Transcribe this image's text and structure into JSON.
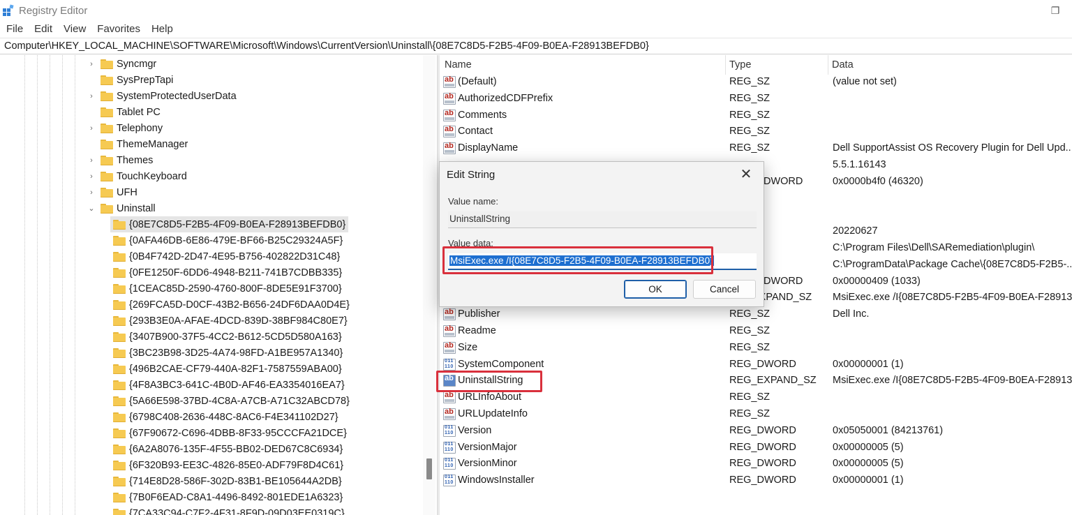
{
  "window": {
    "title": "Registry Editor",
    "restore_glyph": "❐"
  },
  "menu": [
    "File",
    "Edit",
    "View",
    "Favorites",
    "Help"
  ],
  "address": "Computer\\HKEY_LOCAL_MACHINE\\SOFTWARE\\Microsoft\\Windows\\CurrentVersion\\Uninstall\\{08E7C8D5-F2B5-4F09-B0EA-F28913BEFDB0}",
  "tree": {
    "items": [
      {
        "label": "Syncmgr",
        "chevron": "›"
      },
      {
        "label": "SysPrepTapi",
        "chevron": ""
      },
      {
        "label": "SystemProtectedUserData",
        "chevron": "›"
      },
      {
        "label": "Tablet PC",
        "chevron": ""
      },
      {
        "label": "Telephony",
        "chevron": "›"
      },
      {
        "label": "ThemeManager",
        "chevron": ""
      },
      {
        "label": "Themes",
        "chevron": "›"
      },
      {
        "label": "TouchKeyboard",
        "chevron": "›"
      },
      {
        "label": "UFH",
        "chevron": "›"
      },
      {
        "label": "Uninstall",
        "chevron": "⌄"
      }
    ],
    "children": [
      "{08E7C8D5-F2B5-4F09-B0EA-F28913BEFDB0}",
      "{0AFA46DB-6E86-479E-BF66-B25C29324A5F}",
      "{0B4F742D-2D47-4E95-B756-402822D31C48}",
      "{0FE1250F-6DD6-4948-B211-741B7CDBB335}",
      "{1CEAC85D-2590-4760-800F-8DE5E91F3700}",
      "{269FCA5D-D0CF-43B2-B656-24DF6DAA0D4E}",
      "{293B3E0A-AFAE-4DCD-839D-38BF984C80E7}",
      "{3407B900-37F5-4CC2-B612-5CD5D580A163}",
      "{3BC23B98-3D25-4A74-98FD-A1BE957A1340}",
      "{496B2CAE-CF79-440A-82F1-7587559ABA00}",
      "{4F8A3BC3-641C-4B0D-AF46-EA3354016EA7}",
      "{5A66E598-37BD-4C8A-A7CB-A71C32ABCD78}",
      "{6798C408-2636-448C-8AC6-F4E341102D27}",
      "{67F90672-C696-4DBB-8F33-95CCCFA21DCE}",
      "{6A2A8076-135F-4F55-BB02-DED67C8C6934}",
      "{6F320B93-EE3C-4826-85E0-ADF79F8D4C61}",
      "{714E8D28-586F-302D-83B1-BE105644A2DB}",
      "{7B0F6EAD-C8A1-4496-8492-801EDE1A6323}",
      "{7CA33C94-C7F2-4F31-8F9D-09D03EE0319C}"
    ],
    "selected_index": 0
  },
  "columns": {
    "name": "Name",
    "type": "Type",
    "data": "Data"
  },
  "values": [
    {
      "name": "(Default)",
      "type": "REG_SZ",
      "data": "(value not set)",
      "icon": "ab"
    },
    {
      "name": "AuthorizedCDFPrefix",
      "type": "REG_SZ",
      "data": "",
      "icon": "ab"
    },
    {
      "name": "Comments",
      "type": "REG_SZ",
      "data": "",
      "icon": "ab"
    },
    {
      "name": "Contact",
      "type": "REG_SZ",
      "data": "",
      "icon": "ab"
    },
    {
      "name": "DisplayName",
      "type": "REG_SZ",
      "data": "Dell SupportAssist OS Recovery Plugin for Dell Upd...",
      "icon": "ab"
    },
    {
      "name": "",
      "type": "",
      "data": "5.5.1.16143",
      "icon": ""
    },
    {
      "name": "",
      "type": "DWORD",
      "data": "0x0000b4f0 (46320)",
      "icon": ""
    },
    {
      "name": "",
      "type": "",
      "data": "",
      "icon": ""
    },
    {
      "name": "",
      "type": "",
      "data": "",
      "icon": ""
    },
    {
      "name": "",
      "type": "",
      "data": "20220627",
      "icon": ""
    },
    {
      "name": "",
      "type": "",
      "data": "C:\\Program Files\\Dell\\SARemediation\\plugin\\",
      "icon": ""
    },
    {
      "name": "",
      "type": "",
      "data": "C:\\ProgramData\\Package Cache\\{08E7C8D5-F2B5-...",
      "icon": ""
    },
    {
      "name": "",
      "type": "DWORD",
      "data": "0x00000409 (1033)",
      "icon": ""
    },
    {
      "name": "",
      "type": "EXPAND_SZ",
      "data": "MsiExec.exe /I{08E7C8D5-F2B5-4F09-B0EA-F28913...",
      "icon": ""
    },
    {
      "name": "Publisher",
      "type": "REG_SZ",
      "data": "Dell Inc.",
      "icon": "ab"
    },
    {
      "name": "Readme",
      "type": "REG_SZ",
      "data": "",
      "icon": "ab"
    },
    {
      "name": "Size",
      "type": "REG_SZ",
      "data": "",
      "icon": "ab"
    },
    {
      "name": "SystemComponent",
      "type": "REG_DWORD",
      "data": "0x00000001 (1)",
      "icon": "bin"
    },
    {
      "name": "UninstallString",
      "type": "REG_EXPAND_SZ",
      "data": "MsiExec.exe /I{08E7C8D5-F2B5-4F09-B0EA-F28913...",
      "icon": "exp"
    },
    {
      "name": "URLInfoAbout",
      "type": "REG_SZ",
      "data": "",
      "icon": "ab"
    },
    {
      "name": "URLUpdateInfo",
      "type": "REG_SZ",
      "data": "",
      "icon": "ab"
    },
    {
      "name": "Version",
      "type": "REG_DWORD",
      "data": "0x05050001 (84213761)",
      "icon": "bin"
    },
    {
      "name": "VersionMajor",
      "type": "REG_DWORD",
      "data": "0x00000005 (5)",
      "icon": "bin"
    },
    {
      "name": "VersionMinor",
      "type": "REG_DWORD",
      "data": "0x00000005 (5)",
      "icon": "bin"
    },
    {
      "name": "WindowsInstaller",
      "type": "REG_DWORD",
      "data": "0x00000001 (1)",
      "icon": "bin"
    }
  ],
  "dialog": {
    "title": "Edit String",
    "close_glyph": "✕",
    "value_name_label": "Value name:",
    "value_name": "UninstallString",
    "value_data_label": "Value data:",
    "value_data": "MsiExec.exe /I{08E7C8D5-F2B5-4F09-B0EA-F28913BEFDB0}",
    "ok_label": "OK",
    "cancel_label": "Cancel"
  },
  "colors": {
    "highlight": "#d9303c",
    "selection": "#1e6fd0"
  }
}
